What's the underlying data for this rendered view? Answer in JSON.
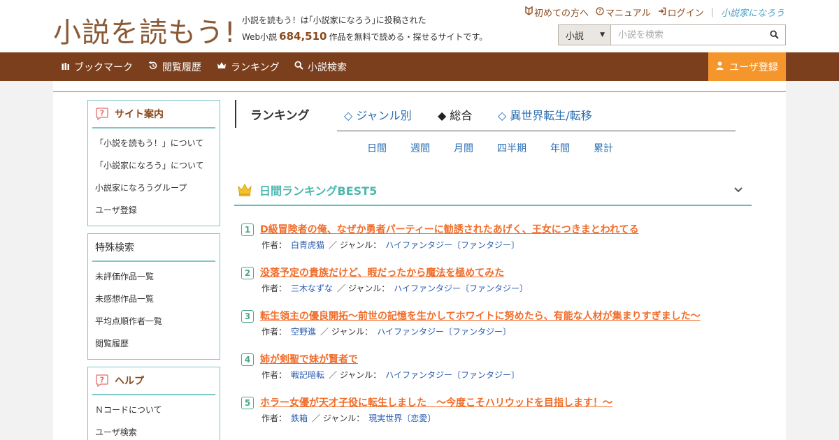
{
  "site": {
    "logo": "小説を読もう!",
    "tagline_line1": "小説を読もう！は｢小説家になろう｣に投稿された",
    "tagline_pre": "Web小説",
    "tagline_count": "684,510",
    "tagline_post": "作品を無料で読める・探せるサイトです。",
    "toplinks": [
      {
        "icon": "beginner-icon",
        "label": "初めての方へ"
      },
      {
        "icon": "question-circle-icon",
        "label": "マニュアル"
      },
      {
        "icon": "login-icon",
        "label": "ログイン"
      }
    ],
    "brand_link": "小説家になろう"
  },
  "search": {
    "type_value": "小説",
    "placeholder": "小説を検索",
    "button_icon": "search-icon"
  },
  "nav": {
    "items": [
      {
        "icon": "bookmark-icon",
        "label": "ブックマーク"
      },
      {
        "icon": "history-icon",
        "label": "閲覧履歴"
      },
      {
        "icon": "crown-icon",
        "label": "ランキング"
      },
      {
        "icon": "search-icon",
        "label": "小説検索"
      }
    ],
    "register": {
      "icon": "user-icon",
      "label": "ユーザ登録"
    }
  },
  "sidebar": {
    "guide": {
      "title": "サイト案内",
      "items": [
        "「小説を読もう！」について",
        "「小説家になろう」について",
        "小説家になろうグループ",
        "ユーザ登録"
      ]
    },
    "special": {
      "title": "特殊検索",
      "items": [
        "未評価作品一覧",
        "未感想作品一覧",
        "平均点順作者一覧",
        "閲覧履歴"
      ]
    },
    "help": {
      "title": "ヘルプ",
      "items": [
        "Ｎコードについて",
        "ユーザ検索"
      ]
    }
  },
  "ranking": {
    "title": "ランキング",
    "tabs": [
      {
        "label": "◇ ジャンル別",
        "active": false
      },
      {
        "label": "◆ 総合",
        "active": true
      },
      {
        "label": "◇ 異世界転生/転移",
        "active": false
      }
    ],
    "periods": [
      "日間",
      "週間",
      "月間",
      "四半期",
      "年間",
      "累計"
    ],
    "best_title": "日間ランキングBEST5",
    "author_label": "作者：",
    "genre_label": "／ ジャンル：",
    "entries": [
      {
        "num": "1",
        "title": "D級冒険者の俺、なぜか勇者パーティーに勧誘されたあげく、王女につきまとわれてる",
        "author": "白青虎猫",
        "genre": "ハイファンタジー〔ファンタジー〕"
      },
      {
        "num": "2",
        "title": "没落予定の貴族だけど、暇だったから魔法を極めてみた",
        "author": "三木なずな",
        "genre": "ハイファンタジー〔ファンタジー〕"
      },
      {
        "num": "3",
        "title": "転生領主の優良開拓〜前世の記憶を生かしてホワイトに努めたら、有能な人材が集まりすぎました〜",
        "author": "空野進",
        "genre": "ハイファンタジー〔ファンタジー〕"
      },
      {
        "num": "4",
        "title": "姉が剣聖で妹が賢者で",
        "author": "戦記暗転",
        "genre": "ハイファンタジー〔ファンタジー〕"
      },
      {
        "num": "5",
        "title": "ホラー女優が天才子役に転生しました　～今度こそハリウッドを目指します！～",
        "author": "鉄箱",
        "genre": "現実世界〔恋愛〕"
      }
    ]
  },
  "colors": {
    "brand_brown": "#7b3f1d",
    "register_orange": "#f5962d",
    "teal": "#4bb8ae",
    "rank_title_orange": "#f16d2b",
    "link_blue": "#2a6fb3"
  }
}
